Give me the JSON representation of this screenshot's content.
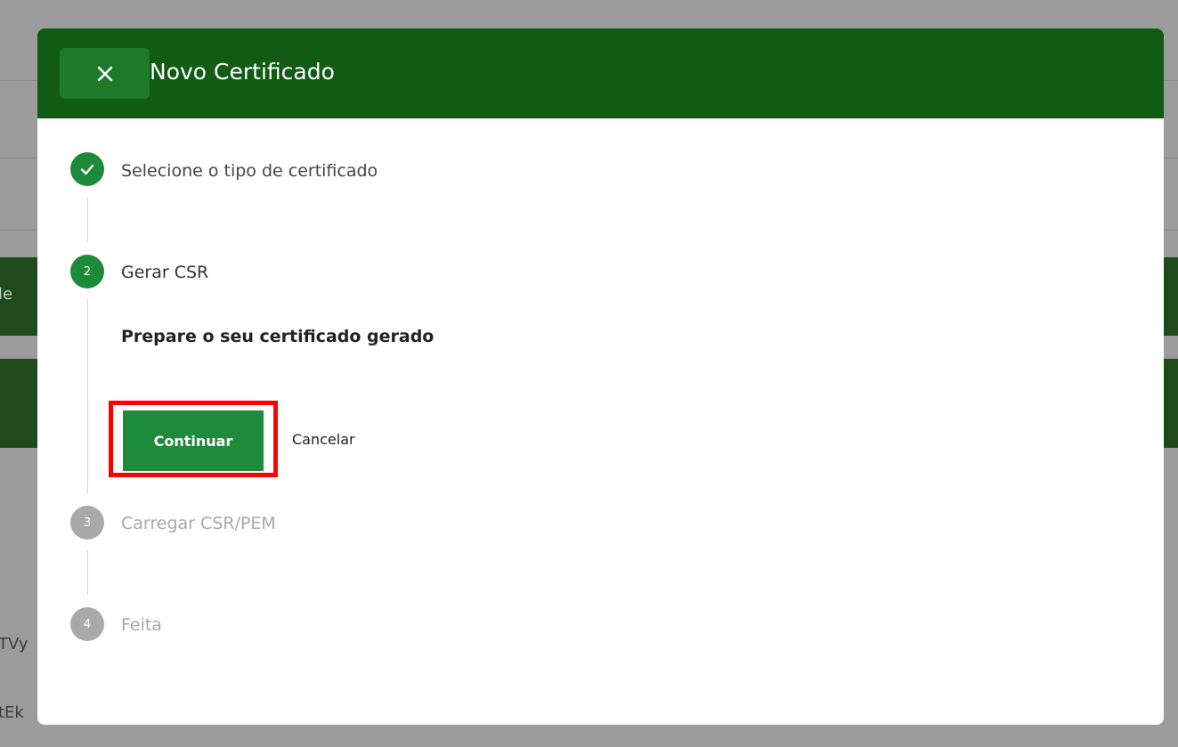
{
  "background": {
    "fragments": [
      "le",
      "TVy",
      "tEk"
    ]
  },
  "modal": {
    "title": "Novo Certificado",
    "close_icon": "close-icon",
    "steps": [
      {
        "number": "1",
        "label": "Selecione o tipo de certificado",
        "state": "done",
        "icon": "check-icon"
      },
      {
        "number": "2",
        "label": "Gerar CSR",
        "state": "active"
      },
      {
        "number": "3",
        "label": "Carregar CSR/PEM",
        "state": "pending"
      },
      {
        "number": "4",
        "label": "Feita",
        "state": "pending"
      }
    ],
    "active_step": {
      "description": "Prepare o seu certificado gerado",
      "continue_label": "Continuar",
      "cancel_label": "Cancelar"
    }
  },
  "colors": {
    "header": "#115b15",
    "accent": "#1e8a3c",
    "pending": "#a9a9a9",
    "highlight": "#ff0000"
  }
}
